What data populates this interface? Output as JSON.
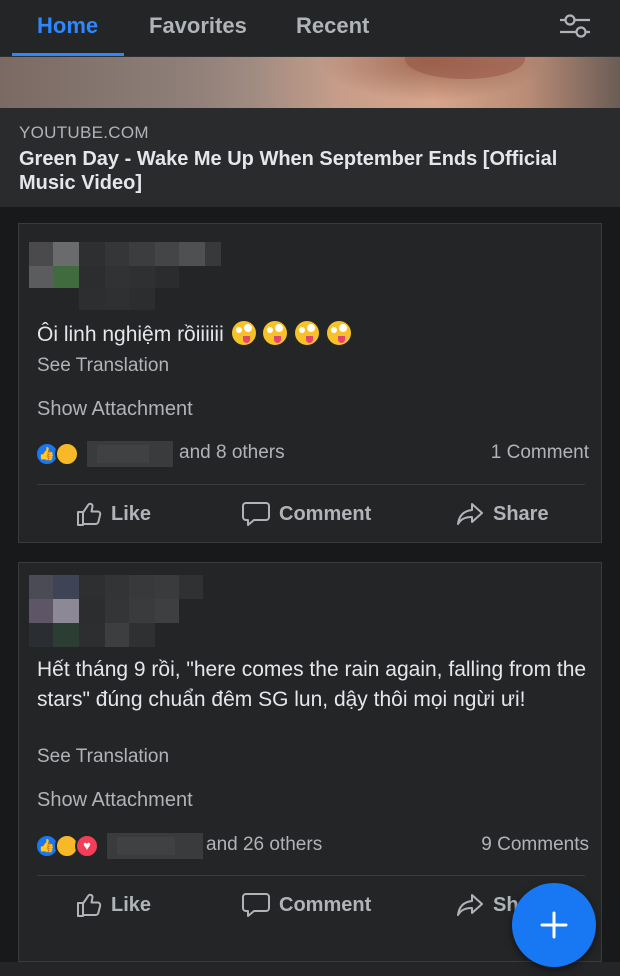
{
  "nav": {
    "tabs": [
      {
        "label": "Home",
        "active": true
      },
      {
        "label": "Favorites",
        "active": false
      },
      {
        "label": "Recent",
        "active": false
      }
    ],
    "filter_icon": "sliders-icon",
    "accent_color": "#2d88ff"
  },
  "link_preview": {
    "source": "YOUTUBE.COM",
    "title": "Green Day - Wake Me Up When September Ends [Official Music Video]"
  },
  "posts": [
    {
      "author": "",
      "text": "Ôi linh nghiệm rồiiiiii",
      "emoji": [
        "zany-face",
        "zany-face",
        "zany-face",
        "zany-face"
      ],
      "see_translation": "See Translation",
      "show_attachment": "Show Attachment",
      "reactions": [
        "like",
        "haha"
      ],
      "reactors_text": "and 8 others",
      "comments": "1 Comment",
      "actions": {
        "like": "Like",
        "comment": "Comment",
        "share": "Share"
      }
    },
    {
      "author": "",
      "text": "Hết tháng 9 rồi, \"here comes the rain again, falling from the stars\" đúng chuẩn đêm SG lun, dậy thôi mọi ngừi ưi!",
      "see_translation": "See Translation",
      "show_attachment": "Show Attachment",
      "reactions": [
        "like",
        "haha",
        "love"
      ],
      "reactors_text": "and 26 others",
      "comments": "9 Comments",
      "actions": {
        "like": "Like",
        "comment": "Comment",
        "share": "Sh"
      }
    }
  ],
  "fab": {
    "icon": "plus-icon",
    "color": "#1877f2"
  }
}
